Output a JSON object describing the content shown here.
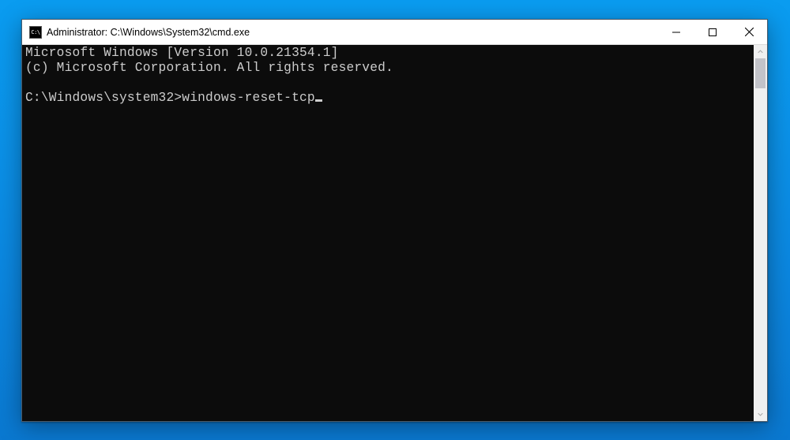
{
  "window": {
    "title": "Administrator: C:\\Windows\\System32\\cmd.exe",
    "icon_label": "C:\\"
  },
  "console": {
    "banner_line1": "Microsoft Windows [Version 10.0.21354.1]",
    "banner_line2": "(c) Microsoft Corporation. All rights reserved.",
    "prompt": "C:\\Windows\\system32>",
    "command": "windows-reset-tcp"
  }
}
